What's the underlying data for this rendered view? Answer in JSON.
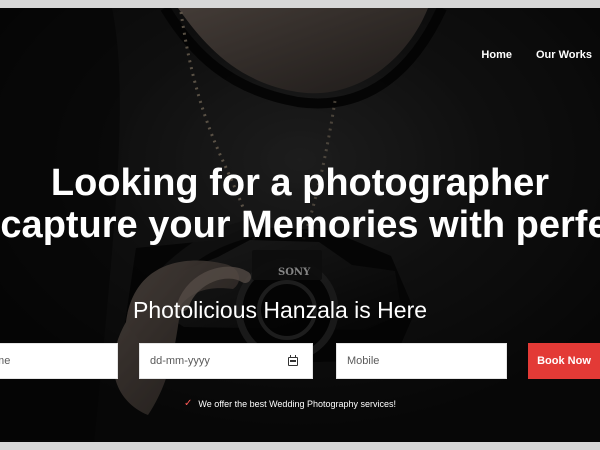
{
  "navigation": {
    "items": [
      {
        "label": "Home"
      },
      {
        "label": "Our Works"
      }
    ]
  },
  "hero": {
    "headline_line_1": "Looking for a photographer",
    "headline_line_2": "to capture your Memories with perfection",
    "subtitle": "Photolicious Hanzala is Here",
    "camera_brand": "SONY"
  },
  "booking_form": {
    "name": {
      "placeholder": "Name"
    },
    "date": {
      "placeholder": "dd-mm-yyyy"
    },
    "mobile": {
      "placeholder": "Mobile"
    },
    "book_button_label": "Book Now"
  },
  "offer": {
    "text": "We offer the best Wedding Photography services!"
  },
  "icons": {
    "calendar": "calendar-icon",
    "check": "check-icon"
  },
  "colors": {
    "accent_red": "#e33a36",
    "check_red": "#ff5a56",
    "text_white": "#ffffff",
    "background_dark": "#0b0b0b",
    "outer_frame": "#d7d7d7"
  }
}
